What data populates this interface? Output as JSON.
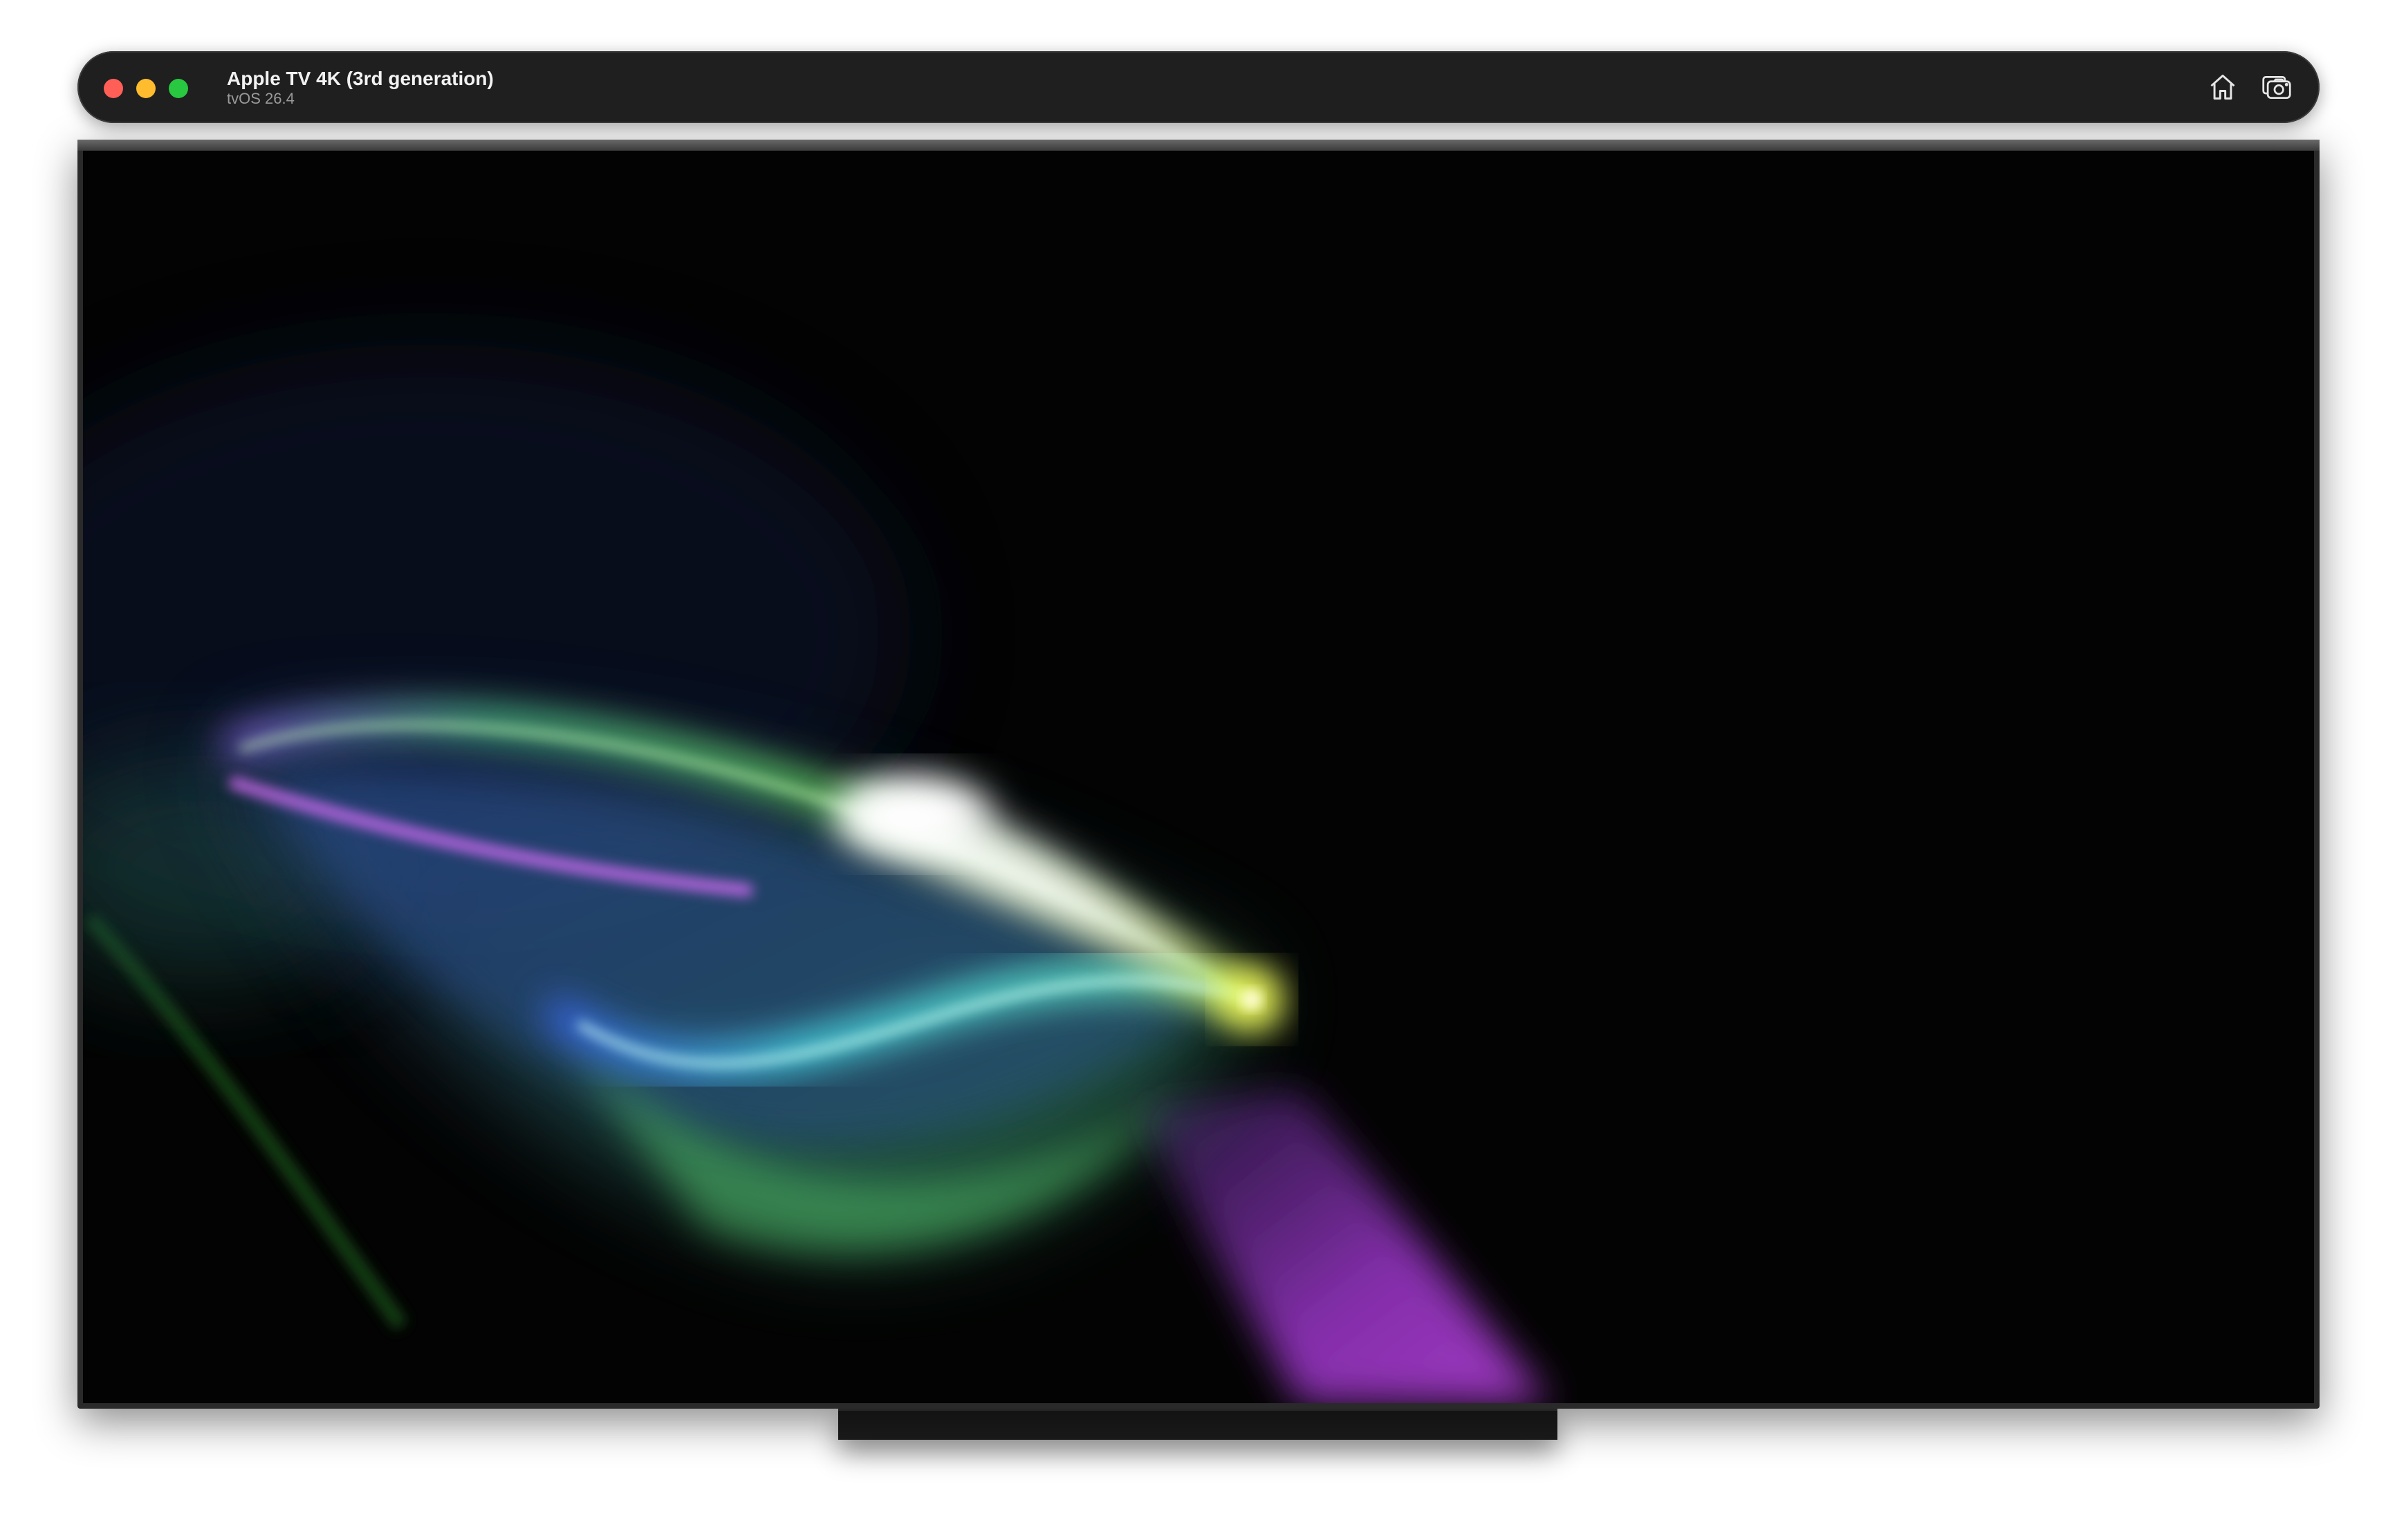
{
  "window": {
    "title": "Apple TV 4K (3rd generation)",
    "subtitle": "tvOS 26.4",
    "traffic_lights": {
      "close_color": "#ff5f57",
      "minimize_color": "#febc2e",
      "zoom_color": "#28c840"
    },
    "toolbar": {
      "home_icon": "home-icon",
      "screenshot_icon": "camera-screenshot-icon"
    }
  },
  "screen": {
    "content": "siri-glow-animation",
    "colors": {
      "green": "#7cff6a",
      "cyan": "#4ff3ff",
      "blue": "#3d6bff",
      "purple": "#a03bd6",
      "pink": "#e070ff",
      "yellow": "#f4ff5a",
      "white": "#ffffff"
    }
  }
}
